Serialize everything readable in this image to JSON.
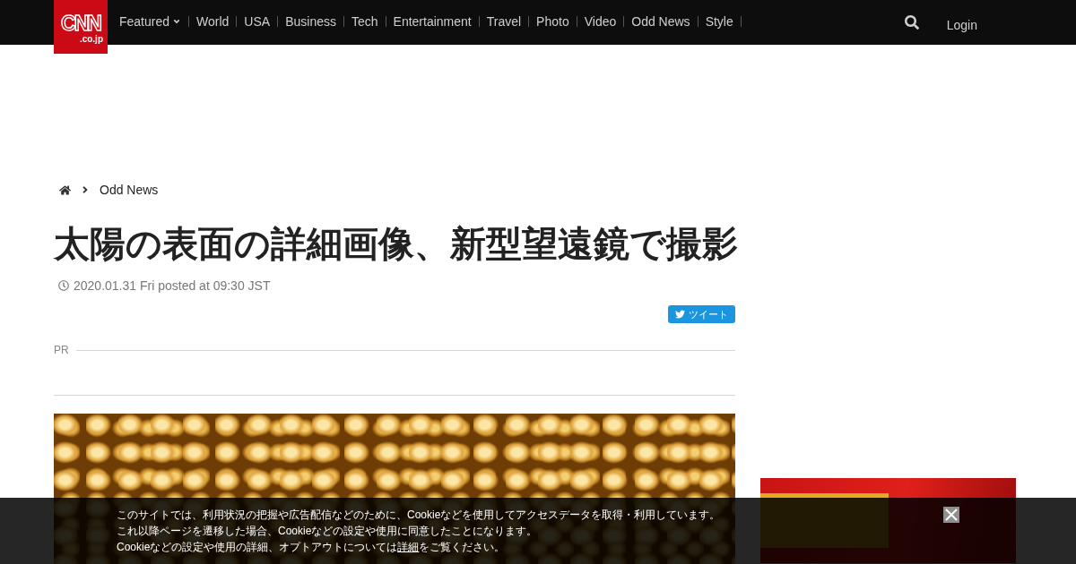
{
  "header": {
    "logo": {
      "text": "CNN",
      "subtext": ".co.jp"
    },
    "nav": [
      {
        "label": "Featured",
        "kind": "dropdown"
      },
      {
        "label": "World",
        "kind": "link"
      },
      {
        "label": "USA",
        "kind": "link"
      },
      {
        "label": "Business",
        "kind": "link"
      },
      {
        "label": "Tech",
        "kind": "link"
      },
      {
        "label": "Entertainment",
        "kind": "link"
      },
      {
        "label": "Travel",
        "kind": "link"
      },
      {
        "label": "Photo",
        "kind": "link"
      },
      {
        "label": "Video",
        "kind": "link"
      },
      {
        "label": "Odd News",
        "kind": "link"
      },
      {
        "label": "Style",
        "kind": "link"
      }
    ],
    "login": "Login"
  },
  "breadcrumb": {
    "items": [
      "Odd News"
    ]
  },
  "article": {
    "title": "太陽の表面の詳細画像、新型望遠鏡で撮影",
    "date": "2020.01.31 Fri posted at 09:30 JST",
    "tweet_button": "ツイート",
    "pr_label": "PR"
  },
  "cookie_notice": {
    "lines": [
      "このサイトでは、利用状況の把握や広告配信などのために、Cookieなどを使用してアクセスデータを取得・利用しています。",
      "これ以降ページを遷移した場合、Cookieなどの設定や使用に同意したことになります。"
    ],
    "closing": {
      "before": "Cookieなどの設定や使用の詳細、オプトアウトについては",
      "link": "詳細",
      "after": "をご覧ください。"
    }
  }
}
